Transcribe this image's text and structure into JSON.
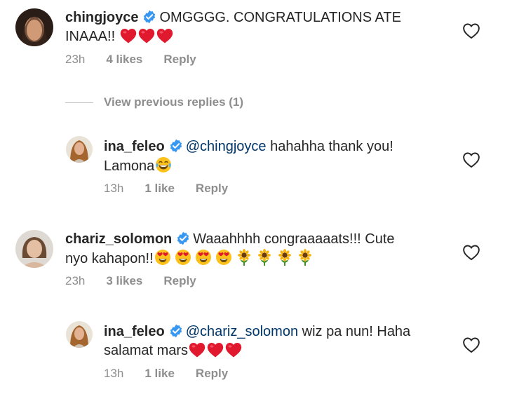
{
  "comments": [
    {
      "username": "chingjoyce",
      "text": "OMGGGG. CONGRATULATIONS ATE",
      "text_line2": "INAAA!!",
      "emojis": [
        "red-heart",
        "red-heart",
        "red-heart"
      ],
      "time": "23h",
      "likes": "4 likes",
      "reply": "Reply"
    },
    {
      "username": "ina_feleo",
      "mention": "@chingjoyce",
      "text": "hahahha thank you!",
      "text_line2": "Lamona",
      "emojis": [
        "tears-of-joy"
      ],
      "time": "13h",
      "likes": "1 like",
      "reply": "Reply"
    },
    {
      "username": "chariz_solomon",
      "text": "Waaahhhh congraaaaats!!! Cute",
      "text_line2": "nyo kahapon!!",
      "emojis": [
        "heart-eyes",
        "heart-eyes",
        "heart-eyes",
        "heart-eyes",
        "sunflower",
        "sunflower",
        "sunflower",
        "sunflower"
      ],
      "time": "23h",
      "likes": "3 likes",
      "reply": "Reply"
    },
    {
      "username": "ina_feleo",
      "mention": "@chariz_solomon",
      "text": "wiz pa nun! Haha",
      "text_line2": "salamat mars",
      "emojis": [
        "red-heart",
        "red-heart",
        "red-heart"
      ],
      "time": "13h",
      "likes": "1 like",
      "reply": "Reply"
    }
  ],
  "view_previous": "View previous replies (1)",
  "colors": {
    "text": "#262626",
    "muted": "#8e8e8e",
    "mention": "#00376b",
    "verified": "#3897f0",
    "heart": "#ed4956"
  }
}
